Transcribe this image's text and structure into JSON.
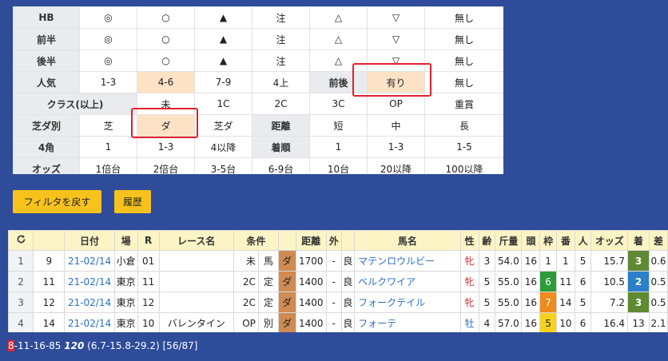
{
  "filter": {
    "rows": [
      {
        "label": "HB",
        "cells": [
          "◎",
          "○",
          "▲",
          "注",
          "△",
          "▽",
          "無し"
        ]
      },
      {
        "label": "前半",
        "cells": [
          "◎",
          "○",
          "▲",
          "注",
          "△",
          "▽",
          "無し"
        ]
      },
      {
        "label": "後半",
        "cells": [
          "◎",
          "○",
          "▲",
          "注",
          "△",
          "▽",
          "無し"
        ]
      },
      {
        "label": "人気",
        "cells": [
          "1-3",
          "4-6",
          "7-9",
          "4上",
          "前後",
          "有り",
          "無し"
        ]
      },
      {
        "label": "クラス(以上)",
        "cells": [
          "未",
          "1C",
          "2C",
          "3C",
          "OP",
          "重賞"
        ]
      },
      {
        "label": "芝ダ別",
        "cells": [
          "芝",
          "ダ",
          "芝ダ",
          "距離",
          "短",
          "中",
          "長"
        ]
      },
      {
        "label": "4角",
        "cells": [
          "1",
          "1-3",
          "4以降",
          "着順",
          "1",
          "1-3",
          "1-5"
        ]
      },
      {
        "label": "オッズ",
        "cells": [
          "1倍台",
          "2倍台",
          "3-5台",
          "6-9台",
          "10台",
          "20以降",
          "100以降"
        ]
      }
    ]
  },
  "buttons": {
    "reset_filter": "フィルタを戻す",
    "history": "履歴"
  },
  "results": {
    "headers": [
      "日付",
      "場",
      "R",
      "レース名",
      "条件",
      "",
      "",
      "距離",
      "外",
      "",
      "馬名",
      "性",
      "齢",
      "斤量",
      "頭",
      "枠",
      "番",
      "人",
      "オッズ",
      "着",
      "差"
    ],
    "rows": [
      {
        "idx": "1",
        "no": "9",
        "date": "21-02/14",
        "place": "小倉",
        "r": "01",
        "race": "",
        "cls": "未",
        "cond": "馬",
        "surf": "ダ",
        "dist": "1700",
        "out": "-",
        "going": "良",
        "horse": "マテンロウルビー",
        "sex": "牝",
        "age": "3",
        "weight": "54.0",
        "heads": "16",
        "gate": "1",
        "num": "1",
        "pop": "5",
        "odds": "15.7",
        "finish": "3",
        "diff": "0.6"
      },
      {
        "idx": "2",
        "no": "11",
        "date": "21-02/14",
        "place": "東京",
        "r": "11",
        "race": "",
        "cls": "2C",
        "cond": "定",
        "surf": "ダ",
        "dist": "1400",
        "out": "-",
        "going": "良",
        "horse": "ベルクワイア",
        "sex": "牝",
        "age": "5",
        "weight": "55.0",
        "heads": "16",
        "gate": "6",
        "num": "11",
        "pop": "6",
        "odds": "10.5",
        "finish": "2",
        "diff": "0.5"
      },
      {
        "idx": "3",
        "no": "12",
        "date": "21-02/14",
        "place": "東京",
        "r": "12",
        "race": "",
        "cls": "2C",
        "cond": "定",
        "surf": "ダ",
        "dist": "1400",
        "out": "-",
        "going": "良",
        "horse": "フォークテイル",
        "sex": "牝",
        "age": "5",
        "weight": "55.0",
        "heads": "16",
        "gate": "7",
        "num": "14",
        "pop": "5",
        "odds": "7.2",
        "finish": "3",
        "diff": "0.5"
      },
      {
        "idx": "4",
        "no": "14",
        "date": "21-02/14",
        "place": "東京",
        "r": "10",
        "race": "バレンタイン",
        "cls": "OP",
        "cond": "別",
        "surf": "ダ",
        "dist": "1400",
        "out": "-",
        "going": "良",
        "horse": "フォーテ",
        "sex": "牡",
        "age": "4",
        "weight": "57.0",
        "heads": "16",
        "gate": "5",
        "num": "10",
        "pop": "6",
        "odds": "16.4",
        "finish": "13",
        "diff": "2.1"
      }
    ]
  },
  "status": {
    "cursor_char": "8",
    "prefix": "-11-16-85 ",
    "score": "120",
    "rest": " (6.7-15.8-29.2) [56/87]"
  },
  "colors": {
    "background": "#2f4c9a",
    "button": "#f7c21b",
    "selected_cell": "#fde2c5",
    "highlight_box": "#e5202a",
    "header_row": "#fdf4c6",
    "surface_dirt": "#d08b52",
    "gate_1": "#ffffff",
    "gate_5": "#f5d31c",
    "gate_6": "#2e9b3a",
    "gate_7": "#f08b1d",
    "rank_2": "#2b80c9",
    "rank_3": "#5f8a33"
  },
  "icons": {
    "reload": "reload-icon"
  }
}
